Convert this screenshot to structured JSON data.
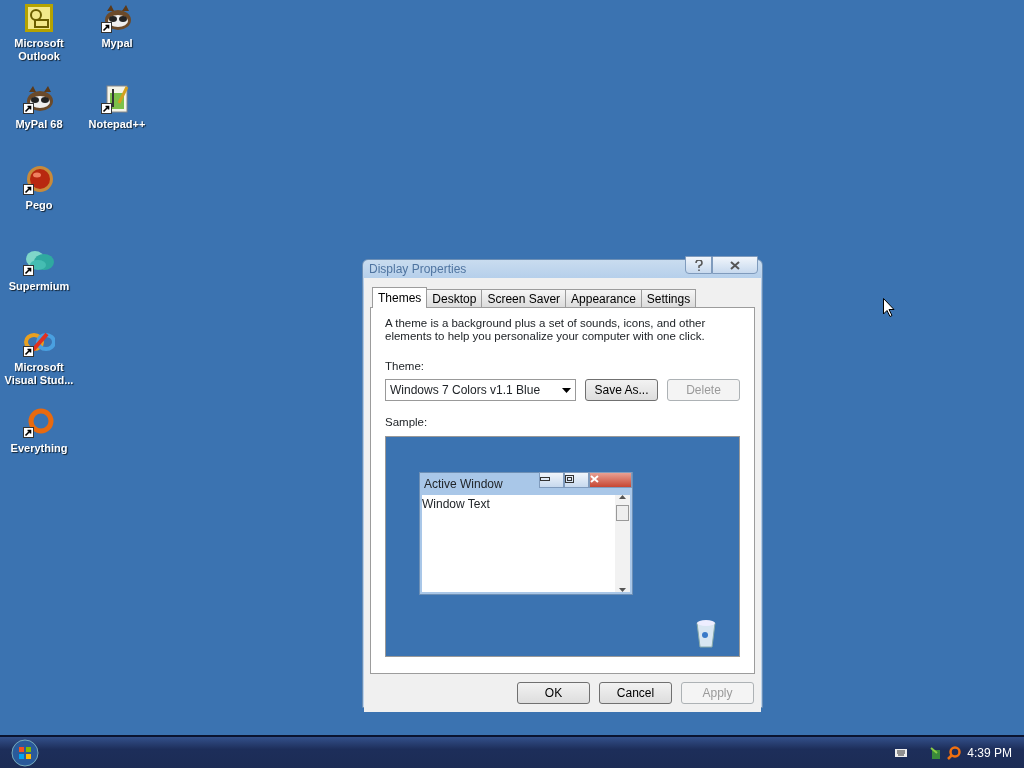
{
  "desktop": {
    "icon_columns": [
      {
        "icons": [
          {
            "label": "Microsoft Outlook",
            "kind": "outlook",
            "shortcut": false
          },
          {
            "label": "MyPal 68",
            "kind": "raccoon",
            "shortcut": true
          },
          {
            "label": "Pego",
            "kind": "orb",
            "shortcut": true
          },
          {
            "label": "Supermium",
            "kind": "cloud",
            "shortcut": true
          },
          {
            "label": "Microsoft Visual Stud...",
            "kind": "infinity",
            "shortcut": true
          },
          {
            "label": "Everything",
            "kind": "ring",
            "shortcut": true
          }
        ]
      },
      {
        "icons": [
          {
            "label": "Mypal",
            "kind": "raccoon",
            "shortcut": true
          },
          {
            "label": "Notepad++",
            "kind": "notepad",
            "shortcut": true
          }
        ]
      }
    ]
  },
  "dialog": {
    "title": "Display Properties",
    "tabs": [
      {
        "label": "Themes",
        "selected": true
      },
      {
        "label": "Desktop",
        "selected": false
      },
      {
        "label": "Screen Saver",
        "selected": false
      },
      {
        "label": "Appearance",
        "selected": false
      },
      {
        "label": "Settings",
        "selected": false
      }
    ],
    "description": "A theme is a background plus a set of sounds, icons, and other elements to help you personalize your computer with one click.",
    "theme_label": "Theme:",
    "theme_value": "Windows 7 Colors v1.1 Blue",
    "theme_buttons": [
      {
        "label": "Save As...",
        "disabled": false
      },
      {
        "label": "Delete",
        "disabled": true
      }
    ],
    "sample_label": "Sample:",
    "sample": {
      "window_title": "Active Window",
      "window_text": "Window Text"
    },
    "buttons": [
      {
        "label": "OK",
        "disabled": false
      },
      {
        "label": "Cancel",
        "disabled": false
      },
      {
        "label": "Apply",
        "disabled": true
      }
    ]
  },
  "taskbar": {
    "clock": "4:39 PM"
  }
}
